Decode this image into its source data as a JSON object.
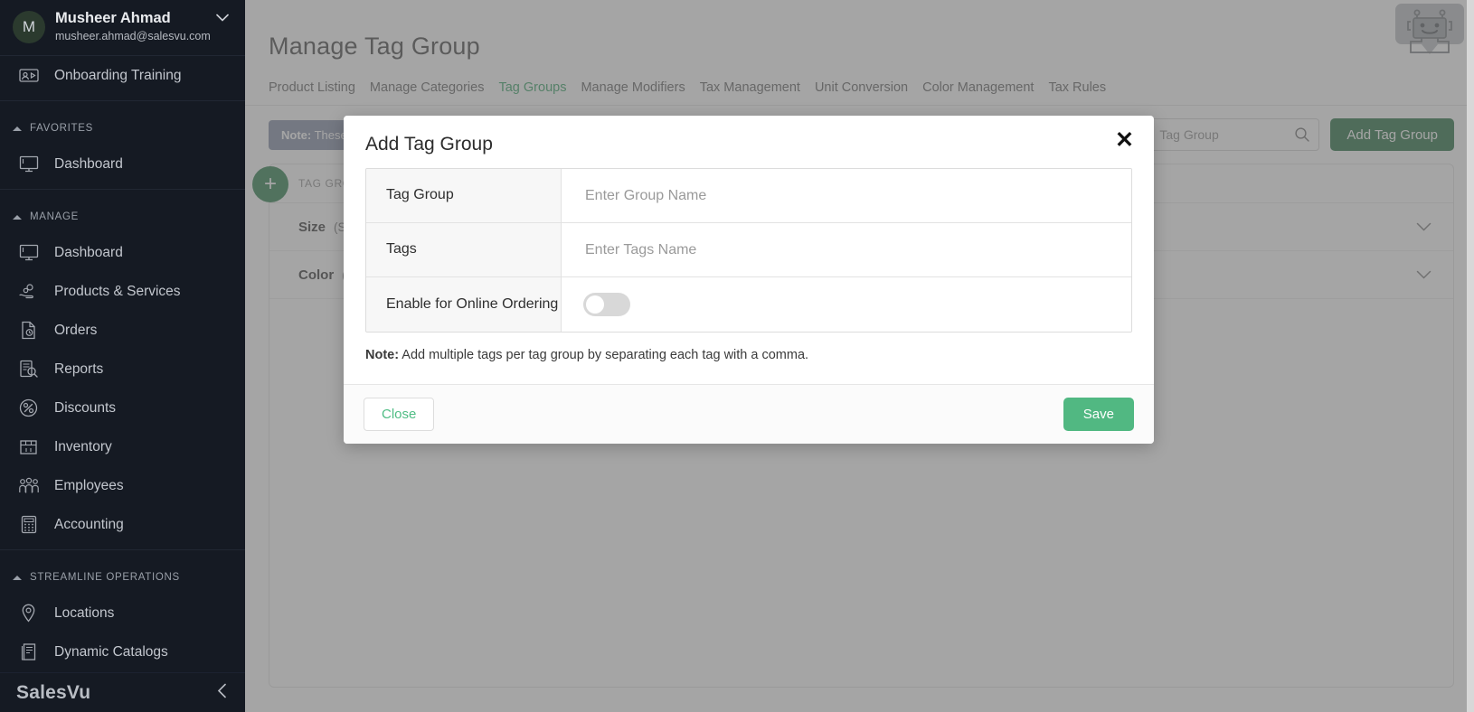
{
  "sidebar": {
    "user": {
      "initial": "M",
      "name": "Musheer Ahmad",
      "email": "musheer.ahmad@salesvu.com",
      "caret_icon": "chevron-down-icon"
    },
    "top_item": {
      "label": "Onboarding Training",
      "icon": "training-screen-icon"
    },
    "sections": [
      {
        "title": "FAVORITES",
        "items": [
          {
            "label": "Dashboard",
            "icon": "monitor-icon"
          }
        ]
      },
      {
        "title": "MANAGE",
        "items": [
          {
            "label": "Dashboard",
            "icon": "monitor-icon"
          },
          {
            "label": "Products & Services",
            "icon": "hand-products-icon"
          },
          {
            "label": "Orders",
            "icon": "document-clock-icon"
          },
          {
            "label": "Reports",
            "icon": "report-magnifier-icon"
          },
          {
            "label": "Discounts",
            "icon": "percent-badge-icon"
          },
          {
            "label": "Inventory",
            "icon": "inventory-box-icon"
          },
          {
            "label": "Employees",
            "icon": "people-group-icon"
          },
          {
            "label": "Accounting",
            "icon": "calculator-icon"
          }
        ]
      },
      {
        "title": "STREAMLINE OPERATIONS",
        "items": [
          {
            "label": "Locations",
            "icon": "map-pin-icon"
          },
          {
            "label": "Dynamic Catalogs",
            "icon": "catalog-book-icon"
          }
        ]
      }
    ],
    "footer": {
      "brand": "SalesVu",
      "collapse_icon": "chevron-left-icon"
    }
  },
  "main": {
    "page_title": "Manage Tag Group",
    "tabs": [
      {
        "label": "Product Listing",
        "active": false
      },
      {
        "label": "Manage Categories",
        "active": false
      },
      {
        "label": "Tag Groups",
        "active": true
      },
      {
        "label": "Manage Modifiers",
        "active": false
      },
      {
        "label": "Tax Management",
        "active": false
      },
      {
        "label": "Unit Conversion",
        "active": false
      },
      {
        "label": "Color Management",
        "active": false
      },
      {
        "label": "Tax Rules",
        "active": false
      }
    ],
    "note_banner_strong": "Note:",
    "note_banner_text": " These",
    "search": {
      "placeholder": "Tag Group",
      "value": "",
      "icon": "search-icon"
    },
    "add_button": "Add Tag Group",
    "fab_icon": "plus-icon",
    "list_header": "TAG GROUPS",
    "rows": [
      {
        "name": "Size",
        "values": "(S,",
        "chevron": "chevron-down-icon"
      },
      {
        "name": "Color",
        "values": "(W",
        "chevron": "chevron-down-icon"
      }
    ],
    "robot_icon": "robot-assistant-icon"
  },
  "modal": {
    "title": "Add Tag Group",
    "close_icon": "close-icon",
    "fields": [
      {
        "label": "Tag Group",
        "placeholder": "Enter Group Name",
        "value": "",
        "type": "text"
      },
      {
        "label": "Tags",
        "placeholder": "Enter Tags Name",
        "value": "",
        "type": "text"
      },
      {
        "label": "Enable for Online Ordering",
        "type": "toggle",
        "enabled": false
      }
    ],
    "note_strong": "Note:",
    "note_text": " Add multiple tags per tag group by separating each tag with a comma.",
    "close_button": "Close",
    "save_button": "Save"
  },
  "colors": {
    "sidebar_bg": "#151a23",
    "accent_green": "#2f9e5f",
    "add_button_green": "#1d6b3b",
    "save_green": "#51b882",
    "note_banner": "#7f8aa3"
  }
}
